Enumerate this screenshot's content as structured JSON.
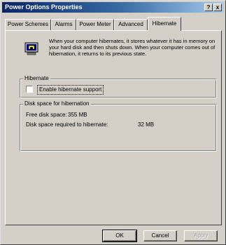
{
  "window": {
    "title": "Power Options Properties",
    "help_label": "?",
    "close_label": "x"
  },
  "tabs": [
    {
      "label": "Power Schemes",
      "active": false
    },
    {
      "label": "Alarms",
      "active": false
    },
    {
      "label": "Power Meter",
      "active": false
    },
    {
      "label": "Advanced",
      "active": false
    },
    {
      "label": "Hibernate",
      "active": true
    }
  ],
  "hibernate_panel": {
    "icon": "hibernate-computer-icon",
    "description": "When your computer hibernates, it stores whatever it has in memory on your hard disk and then shuts down. When your computer comes out of hibernation, it returns to its previous state.",
    "group_hibernate": {
      "label": "Hibernate",
      "checkbox_label": "Enable hibernate support",
      "checked": false
    },
    "group_disk": {
      "label": "Disk space for hibernation",
      "free_label": "Free disk space:",
      "free_value": "355 MB",
      "required_label": "Disk space required to hibernate:",
      "required_value": "32 MB"
    }
  },
  "buttons": {
    "ok": "OK",
    "cancel": "Cancel",
    "apply": "Apply"
  },
  "colors": {
    "title_gradient_start": "#0a246a",
    "title_gradient_end": "#a6caf0",
    "face": "#d4d0c8"
  }
}
